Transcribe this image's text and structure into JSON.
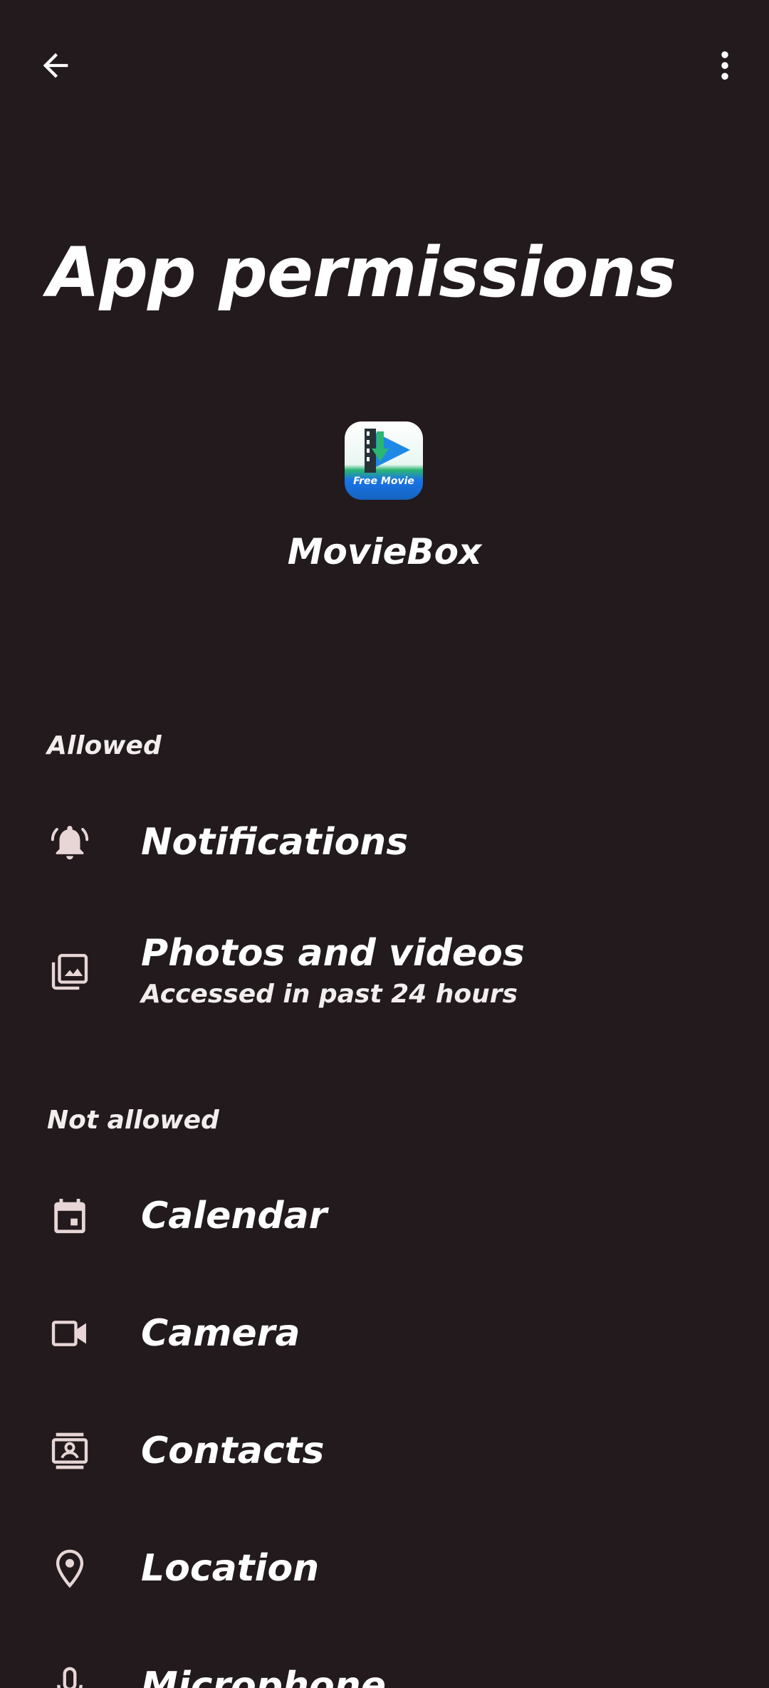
{
  "header": {
    "back_icon": "arrow-left-icon",
    "more_icon": "more-vert-icon"
  },
  "title": "App permissions",
  "app": {
    "name": "MovieBox",
    "icon_text": "Free Movie"
  },
  "sections": {
    "allowed": {
      "label": "Allowed",
      "items": [
        {
          "label": "Notifications",
          "icon": "bell-icon"
        },
        {
          "label": "Photos and videos",
          "subtitle": "Accessed in past 24 hours",
          "icon": "photo-library-icon"
        }
      ]
    },
    "not_allowed": {
      "label": "Not allowed",
      "items": [
        {
          "label": "Calendar",
          "icon": "calendar-icon"
        },
        {
          "label": "Camera",
          "icon": "camera-icon"
        },
        {
          "label": "Contacts",
          "icon": "contacts-icon"
        },
        {
          "label": "Location",
          "icon": "location-icon"
        },
        {
          "label": "Microphone",
          "icon": "microphone-icon"
        }
      ]
    }
  },
  "colors": {
    "background": "#221a1c",
    "text": "#ffffff",
    "icon_tint": "#e8d6d6"
  }
}
